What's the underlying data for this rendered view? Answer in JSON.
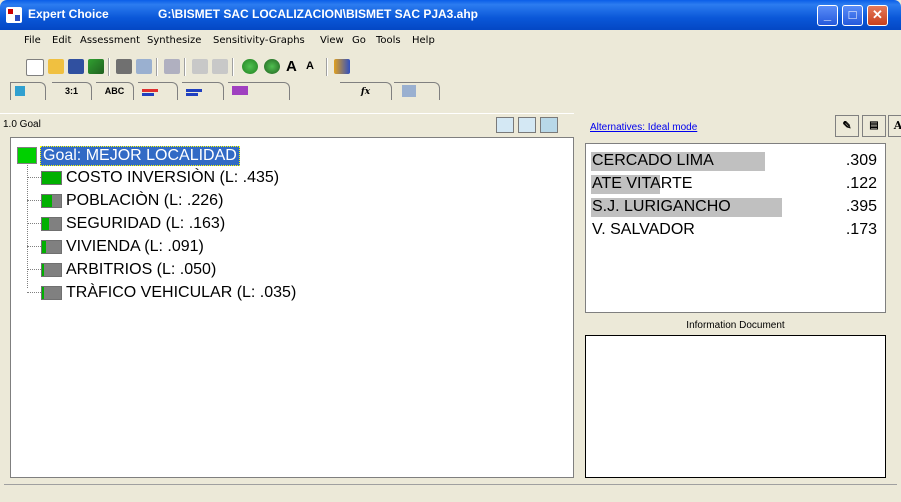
{
  "window": {
    "app_name": "Expert Choice",
    "file_path": "G:\\BISMET SAC LOCALIZACION\\BISMET SAC PJA3.ahp"
  },
  "menu": [
    "File",
    "Edit",
    "Assessment",
    "Synthesize",
    "Sensitivity-Graphs",
    "View",
    "Go",
    "Tools",
    "Help"
  ],
  "toolbar_icons": [
    "new-file-icon",
    "open-folder-icon",
    "save-icon",
    "undo-icon",
    "print-icon",
    "print-preview-icon",
    "insert-node-icon",
    "cut-icon",
    "copy-icon",
    "refresh-icon",
    "refresh-all-icon",
    "font-size-up-icon",
    "font-size-down-icon",
    "users-icon"
  ],
  "tabs": [
    {
      "label": "",
      "icon": "tree-view-icon"
    },
    {
      "label": "3:1",
      "icon": ""
    },
    {
      "label": "ABC",
      "icon": ""
    },
    {
      "label": "",
      "icon": "bar-graph-icon"
    },
    {
      "label": "",
      "icon": "bar-graph-icon"
    },
    {
      "label": "",
      "icon": "hierarchy-icon"
    },
    {
      "label": "",
      "icon": "formula-icon"
    },
    {
      "label": "",
      "icon": "grid-icon"
    }
  ],
  "left_panel": {
    "path": "1.0 Goal",
    "goal": "Goal: MEJOR LOCALIDAD",
    "criteria": [
      {
        "label": "COSTO INVERSIÒN (L: .435)",
        "weight": 0.435
      },
      {
        "label": "POBLACIÒN (L: .226)",
        "weight": 0.226
      },
      {
        "label": "SEGURIDAD (L: .163)",
        "weight": 0.163
      },
      {
        "label": "VIVIENDA (L: .091)",
        "weight": 0.091
      },
      {
        "label": "ARBITRIOS (L: .050)",
        "weight": 0.05
      },
      {
        "label": "TRÀFICO VEHICULAR (L: .035)",
        "weight": 0.035
      }
    ],
    "colors": {
      "goal_box": "#00d000",
      "node_box": "#808080",
      "node_fill": "#00b000",
      "selection": "#316ac5"
    }
  },
  "right_panel": {
    "mode_link": "Alternatives: Ideal mode",
    "alternatives": [
      {
        "name": "CERCADO LIMA",
        "value": ".309"
      },
      {
        "name": "ATE VITARTE",
        "value": ".122"
      },
      {
        "name": "S.J. LURIGANCHO",
        "value": ".395"
      },
      {
        "name": "V. SALVADOR",
        "value": ".173"
      }
    ],
    "info_title": "Information Document"
  }
}
